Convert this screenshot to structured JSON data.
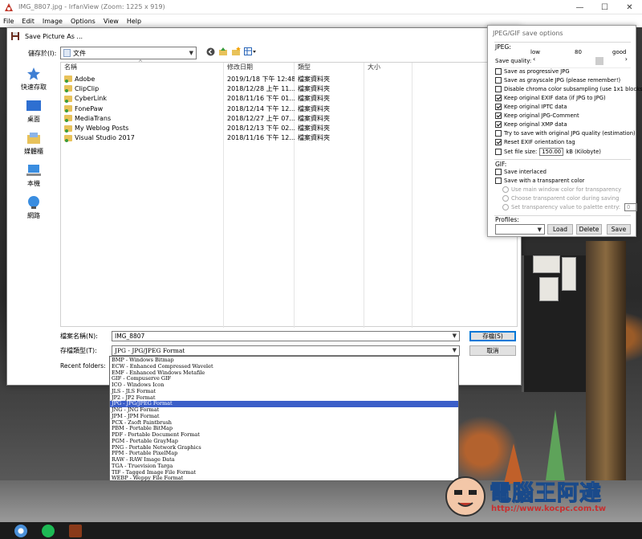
{
  "main_window": {
    "title": "IMG_8807.jpg - IrfanView (Zoom: 1225 x 919)",
    "menu": [
      "File",
      "Edit",
      "Image",
      "Options",
      "View",
      "Help"
    ],
    "controls": {
      "minimize": "—",
      "maximize": "☐",
      "close": "✕"
    }
  },
  "save_dialog": {
    "title": "Save Picture As ...",
    "save_in_label": "儲存於(I):",
    "save_in_value": "文件",
    "places": [
      {
        "label": "快速存取",
        "icon": "star-icon"
      },
      {
        "label": "桌面",
        "icon": "desktop-icon"
      },
      {
        "label": "媒體櫃",
        "icon": "library-icon"
      },
      {
        "label": "本機",
        "icon": "computer-icon"
      },
      {
        "label": "網路",
        "icon": "network-icon"
      }
    ],
    "columns": [
      "名稱",
      "修改日期",
      "類型",
      "大小"
    ],
    "files": [
      {
        "name": "Adobe",
        "date": "2019/1/18 下午 12:48",
        "type": "檔案資料夾"
      },
      {
        "name": "ClipClip",
        "date": "2018/12/28 上午 11...",
        "type": "檔案資料夾"
      },
      {
        "name": "CyberLink",
        "date": "2018/11/16 下午 01...",
        "type": "檔案資料夾"
      },
      {
        "name": "FonePaw",
        "date": "2018/12/14 下午 12...",
        "type": "檔案資料夾"
      },
      {
        "name": "MediaTrans",
        "date": "2018/12/27 上午 07...",
        "type": "檔案資料夾"
      },
      {
        "name": "My Weblog Posts",
        "date": "2018/12/13 下午 02...",
        "type": "檔案資料夾"
      },
      {
        "name": "Visual Studio 2017",
        "date": "2018/11/16 下午 12...",
        "type": "檔案資料夾"
      }
    ],
    "filename_label": "檔案名稱(N):",
    "filename_value": "IMG_8807",
    "filetype_label": "存檔類型(T):",
    "filetype_value": "JPG - JPG/JPEG Format",
    "save_button": "存檔(S)",
    "cancel_button": "取消",
    "recent_label": "Recent folders:",
    "format_options": [
      "BMP - Windows Bitmap",
      "ECW - Enhanced Compressed Wavelet",
      "EMF - Enhanced Windows Metafile",
      "GIF - Compuserve GIF",
      "ICO - Windows Icon",
      "JLS - JLS Format",
      "JP2 - JP2 Format",
      "JPG - JPG/JPEG Format",
      "JNG - JNG Format",
      "JPM - JPM Format",
      "PCX - Zsoft Paintbrush",
      "PBM - Portable BitMap",
      "PDF - Portable Document Format",
      "PGM - Portable GrayMap",
      "PNG - Portable Network Graphics",
      "PPM - Portable PixelMap",
      "RAW - RAW Image Data",
      "TGA - Truevision Targa",
      "TIF - Tagged Image File Format",
      "WEBP - Weppy File Format"
    ],
    "selected_format_index": 7
  },
  "options_panel": {
    "title": "JPEG/GIF save options",
    "jpeg_label": "JPEG:",
    "quality_label": "Save quality:",
    "quality_low": "low",
    "quality_value": "80",
    "quality_good": "good",
    "jpeg_options": [
      {
        "label": "Save as progressive JPG",
        "checked": false
      },
      {
        "label": "Save as grayscale JPG (please remember!)",
        "checked": false
      },
      {
        "label": "Disable chroma color subsampling (use 1x1 blocks)",
        "checked": false
      },
      {
        "label": "Keep original EXIF data (if JPG to JPG)",
        "checked": true
      },
      {
        "label": "Keep original IPTC data",
        "checked": true
      },
      {
        "label": "Keep original JPG-Comment",
        "checked": true
      },
      {
        "label": "Keep original XMP data",
        "checked": true
      },
      {
        "label": "Try to save with original JPG quality (estimation)",
        "checked": false
      },
      {
        "label": "Reset EXIF orientation tag",
        "checked": true
      }
    ],
    "file_size_label": "Set file size:",
    "file_size_value": "150.00",
    "file_size_unit": "kB (Kilobyte)",
    "gif_label": "GIF:",
    "gif_options": [
      {
        "label": "Save interlaced",
        "checked": false
      },
      {
        "label": "Save with a transparent color",
        "checked": false
      }
    ],
    "gif_radios": [
      "Use main window color for transparency",
      "Choose transparent color during saving",
      "Set transparency value to palette entry:"
    ],
    "palette_value": "0",
    "profiles_label": "Profiles:",
    "load_button": "Load",
    "delete_button": "Delete",
    "save_button": "Save"
  },
  "watermark": {
    "title": "電腦王阿達",
    "url": "http://www.kocpc.com.tw"
  },
  "colors": {
    "accent": "#0078d7",
    "selection": "#3b5ec8",
    "folder": "#e8c25a"
  }
}
